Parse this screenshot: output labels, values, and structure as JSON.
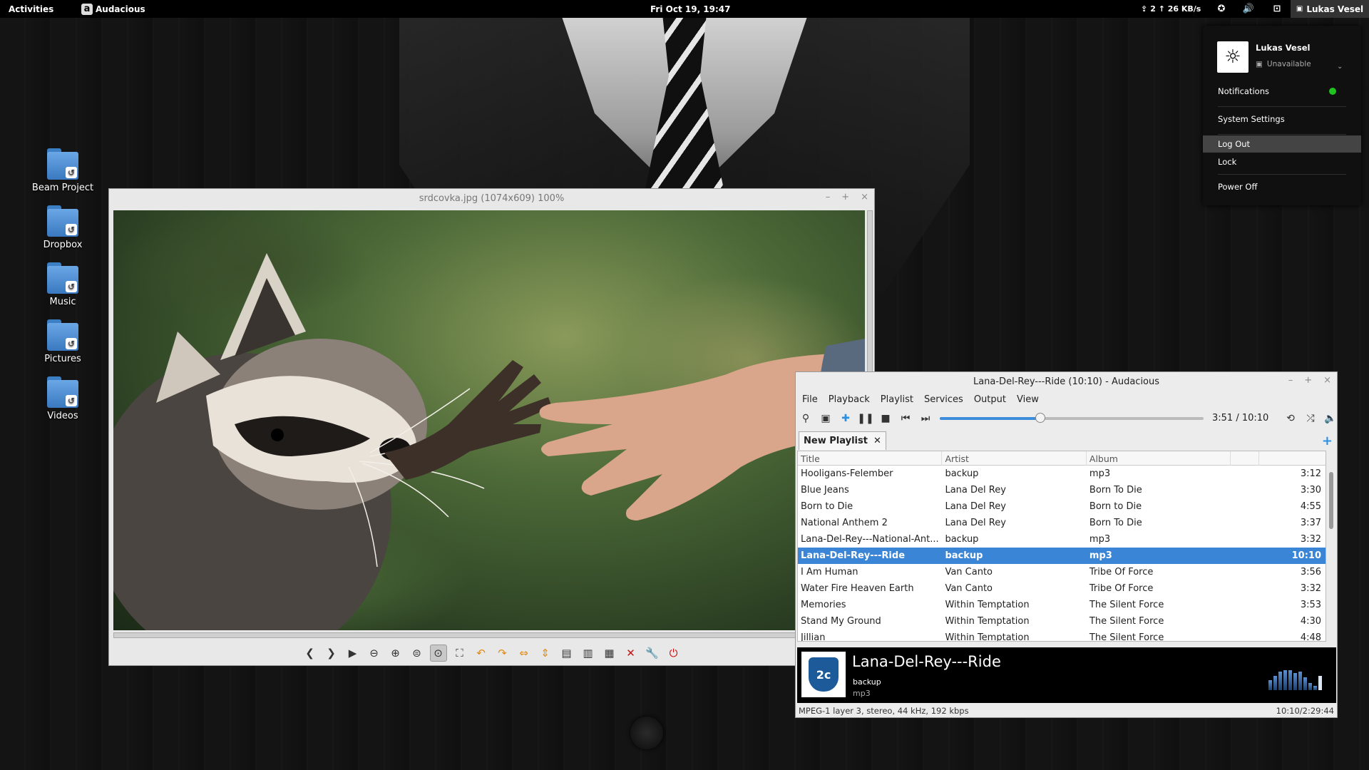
{
  "topbar": {
    "activities": "Activities",
    "app_name": "Audacious",
    "clock": "Fri Oct 19, 19:47",
    "network": "2 ↑ 26 KB/s",
    "user": "Lukas Vesel"
  },
  "user_menu": {
    "name": "Lukas Vesel",
    "status": "Unavailable",
    "notifications": "Notifications",
    "system_settings": "System Settings",
    "log_out": "Log Out",
    "lock": "Lock",
    "power_off": "Power Off"
  },
  "desktop": {
    "icons": [
      "Beam Project",
      "Dropbox",
      "Music",
      "Pictures",
      "Videos"
    ]
  },
  "viewer": {
    "title": "srdcovka.jpg (1074x609) 100%"
  },
  "audacious": {
    "title": "Lana-Del-Rey---Ride (10:10) - Audacious",
    "menu": [
      "File",
      "Playback",
      "Playlist",
      "Services",
      "Output",
      "View"
    ],
    "time": "3:51 / 10:10",
    "progress": 0.38,
    "tab": "New Playlist",
    "columns": [
      "Title",
      "Artist",
      "Album"
    ],
    "rows": [
      {
        "title": "Hooligans-Felember",
        "artist": "backup",
        "album": "mp3",
        "length": "3:12"
      },
      {
        "title": "Blue Jeans",
        "artist": "Lana Del Rey",
        "album": "Born To Die",
        "length": "3:30"
      },
      {
        "title": "Born to Die",
        "artist": "Lana Del Rey",
        "album": "Born to Die",
        "length": "4:55"
      },
      {
        "title": "National Anthem 2",
        "artist": "Lana Del Rey",
        "album": "Born To Die",
        "length": "3:37"
      },
      {
        "title": "Lana-Del-Rey---National-Ant...",
        "artist": "backup",
        "album": "mp3",
        "length": "3:32"
      },
      {
        "title": "Lana-Del-Rey---Ride",
        "artist": "backup",
        "album": "mp3",
        "length": "10:10",
        "selected": true
      },
      {
        "title": "I Am Human",
        "artist": "Van Canto",
        "album": "Tribe Of Force",
        "length": "3:56"
      },
      {
        "title": "Water Fire Heaven Earth",
        "artist": "Van Canto",
        "album": "Tribe Of Force",
        "length": "3:32"
      },
      {
        "title": "Memories",
        "artist": "Within Temptation",
        "album": "The Silent Force",
        "length": "3:53"
      },
      {
        "title": "Stand My Ground",
        "artist": "Within Temptation",
        "album": "The Silent Force",
        "length": "4:30"
      },
      {
        "title": "Jillian",
        "artist": "Within Temptation",
        "album": "The Silent Force",
        "length": "4:48"
      }
    ],
    "now_playing": {
      "title": "Lana-Del-Rey---Ride",
      "artist": "backup",
      "album": "mp3",
      "art_text": "2c"
    },
    "status_left": "MPEG-1 layer 3, stereo, 44 kHz, 192 kbps",
    "status_right": "10:10/2:29:44"
  },
  "colors": {
    "accent": "#3a85d6",
    "online": "#1ec31e"
  }
}
